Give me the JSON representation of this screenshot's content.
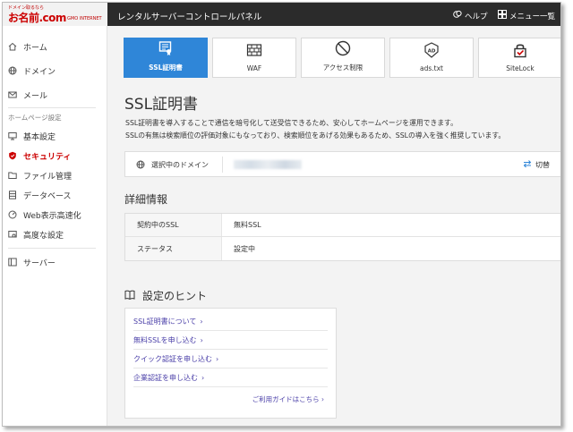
{
  "header": {
    "logo_small": "ドメイン取るなら",
    "logo_main": "お名前.com",
    "logo_brand": "GMO INTERNET",
    "title": "レンタルサーバーコントロールパネル",
    "help_label": "ヘルプ",
    "menu_label": "メニュー一覧"
  },
  "sidebar": {
    "items_top": [
      {
        "label": "ホーム",
        "icon": "home-icon"
      },
      {
        "label": "ドメイン",
        "icon": "globe-icon"
      },
      {
        "label": "メール",
        "icon": "mail-icon"
      }
    ],
    "section_label": "ホームページ設定",
    "items_hp": [
      {
        "label": "基本設定",
        "icon": "monitor-icon"
      },
      {
        "label": "セキュリティ",
        "icon": "shield-icon"
      },
      {
        "label": "ファイル管理",
        "icon": "folder-icon"
      },
      {
        "label": "データベース",
        "icon": "database-icon"
      },
      {
        "label": "Web表示高速化",
        "icon": "speed-icon"
      },
      {
        "label": "高度な設定",
        "icon": "advanced-icon"
      }
    ],
    "server_label": "サーバー"
  },
  "tabs": [
    {
      "label": "SSL証明書",
      "icon": "certificate-icon"
    },
    {
      "label": "WAF",
      "icon": "firewall-icon"
    },
    {
      "label": "アクセス制限",
      "icon": "prohibit-icon"
    },
    {
      "label": "ads.txt",
      "icon": "ads-icon"
    },
    {
      "label": "SiteLock",
      "icon": "lock-icon"
    }
  ],
  "main": {
    "title": "SSL証明書",
    "desc_line1": "SSL証明書を導入することで通信を暗号化して送受信できるため、安心してホームページを運用できます。",
    "desc_line2": "SSLの有無は検索順位の評価対象にもなっており、検索順位をあげる効果もあるため、SSLの導入を強く推奨しています。",
    "domain_label": "選択中のドメイン",
    "switch_label": "切替"
  },
  "detail": {
    "title": "詳細情報",
    "rows": [
      {
        "key": "契約中のSSL",
        "value": "無料SSL"
      },
      {
        "key": "ステータス",
        "value": "設定中"
      }
    ]
  },
  "hints": {
    "title": "設定のヒント",
    "links": [
      "SSL証明書について",
      "無料SSLを申し込む",
      "クイック認証を申し込む",
      "企業認証を申し込む"
    ],
    "guide": "ご利用ガイドはこちら"
  },
  "colors": {
    "accent": "#2f86d8",
    "active_nav": "#cc0000",
    "topbar": "#2b2b2b",
    "link": "#4a3fa8"
  }
}
